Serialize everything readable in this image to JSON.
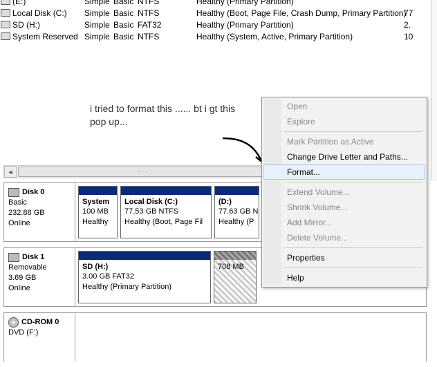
{
  "volumes": [
    {
      "name": "(E:)",
      "layout": "Simple",
      "type": "Basic",
      "fs": "NTFS",
      "status": "Healthy (Primary Partition)",
      "cap": ""
    },
    {
      "name": "Local Disk (C:)",
      "layout": "Simple",
      "type": "Basic",
      "fs": "NTFS",
      "status": "Healthy (Boot, Page File, Crash Dump, Primary Partition)",
      "cap": "77"
    },
    {
      "name": "SD (H:)",
      "layout": "Simple",
      "type": "Basic",
      "fs": "FAT32",
      "status": "Healthy (Primary Partition)",
      "cap": "2."
    },
    {
      "name": "System Reserved",
      "layout": "Simple",
      "type": "Basic",
      "fs": "NTFS",
      "status": "Healthy (System, Active, Primary Partition)",
      "cap": "10"
    }
  ],
  "annotation": {
    "line1": "i tried to format this ...... bt i gt this",
    "line2": "pop up..."
  },
  "disk0": {
    "title": "Disk 0",
    "type": "Basic",
    "size": "232.88 GB",
    "status": "Online",
    "p0": {
      "name": "System",
      "l1": "100 MB",
      "l2": "Healthy"
    },
    "p1": {
      "name": "Local Disk  (C:)",
      "l1": "77.53 GB NTFS",
      "l2": "Healthy (Boot, Page Fil"
    },
    "p2": {
      "name": "(D:)",
      "l1": "77.63 GB N",
      "l2": "Healthy (P"
    }
  },
  "disk1": {
    "title": "Disk 1",
    "type": "Removable",
    "size": "3.69 GB",
    "status": "Online",
    "p0": {
      "name": "SD  (H:)",
      "l1": "3.00 GB FAT32",
      "l2": "Healthy (Primary Partition)"
    },
    "p1": {
      "name": "",
      "l1": "708 MB",
      "l2": ""
    }
  },
  "cd0": {
    "title": "CD-ROM 0",
    "type": "DVD (F:)"
  },
  "menu": {
    "open": "Open",
    "explore": "Explore",
    "mark": "Mark Partition as Active",
    "change": "Change Drive Letter and Paths...",
    "format": "Format...",
    "extend": "Extend Volume...",
    "shrink": "Shrink Volume...",
    "mirror": "Add Mirror...",
    "delete": "Delete Volume...",
    "props": "Properties",
    "help": "Help"
  }
}
